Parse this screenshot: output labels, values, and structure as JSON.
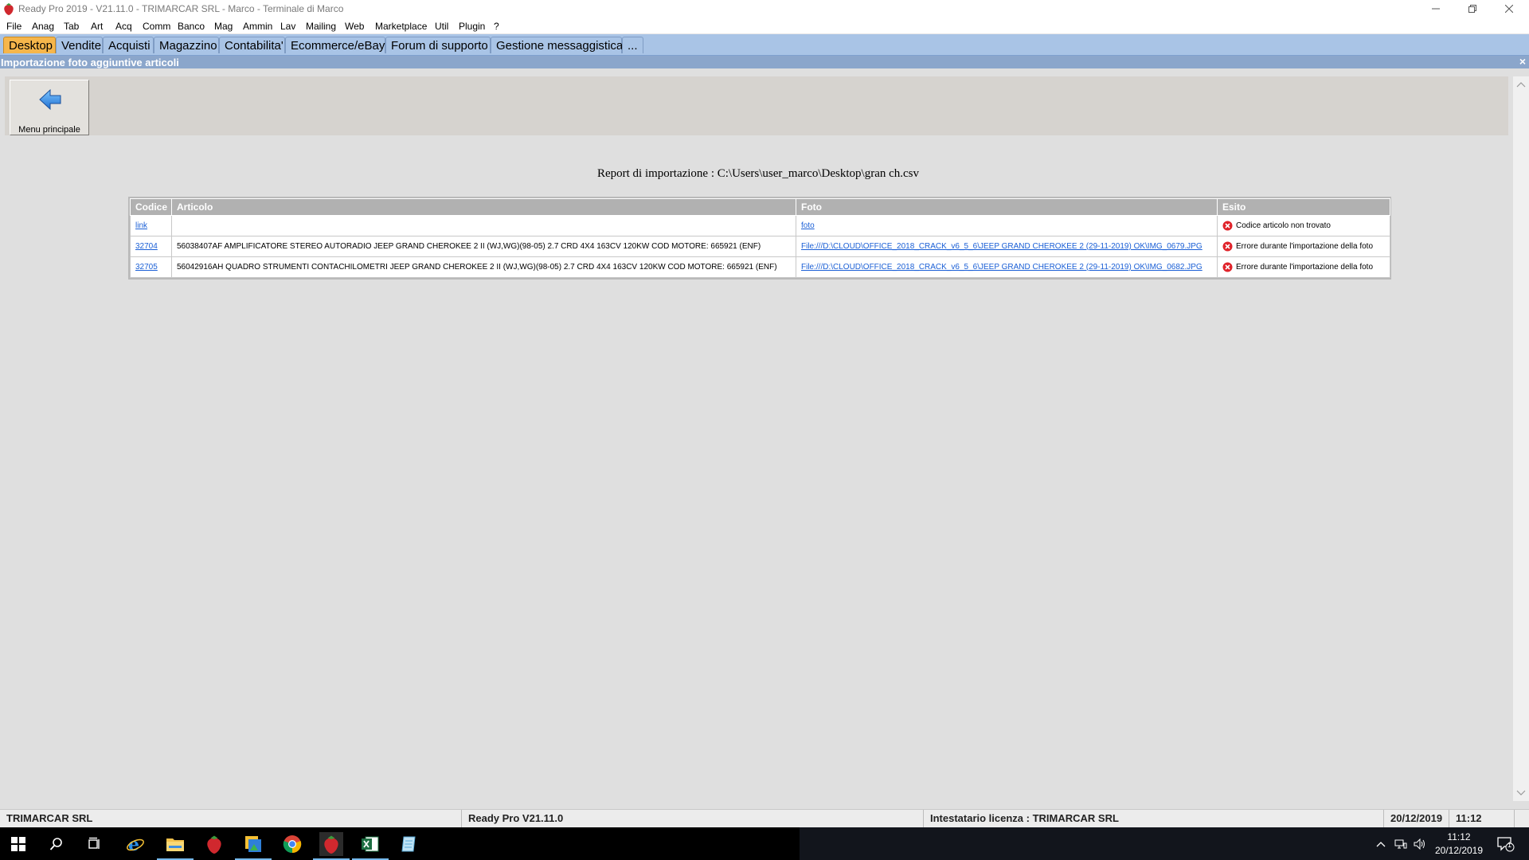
{
  "window": {
    "title": "Ready Pro 2019 - V21.11.0 - TRIMARCAR SRL - Marco - Terminale di Marco"
  },
  "menu": [
    "File",
    "Anag",
    "Tab",
    "Art",
    "Acq",
    "Comm",
    "Banco",
    "Mag",
    "Ammin",
    "Lav",
    "Mailing",
    "Web",
    "Marketplace",
    "Util",
    "Plugin",
    "?"
  ],
  "tabs": [
    {
      "label": "Desktop",
      "active": true
    },
    {
      "label": "Vendite"
    },
    {
      "label": "Acquisti"
    },
    {
      "label": "Magazzino"
    },
    {
      "label": "Contabilita'"
    },
    {
      "label": "Ecommerce/eBay"
    },
    {
      "label": "Forum di supporto"
    },
    {
      "label": "Gestione messaggistica"
    },
    {
      "label": "..."
    }
  ],
  "panel": {
    "title": "Importazione foto aggiuntive articoli",
    "close": "×",
    "back_button_label": "Menu principale"
  },
  "report": {
    "title": "Report di importazione : C:\\Users\\user_marco\\Desktop\\gran ch.csv",
    "columns": [
      "Codice",
      "Articolo",
      "Foto",
      "Esito"
    ],
    "rows": [
      {
        "codice": "link",
        "articolo": "",
        "foto": "foto",
        "esito": "Codice articolo non trovato"
      },
      {
        "codice": "32704",
        "articolo": "56038407AF AMPLIFICATORE STEREO AUTORADIO JEEP GRAND CHEROKEE 2 II (WJ,WG)(98-05) 2.7 CRD 4X4 163CV 120KW COD MOTORE: 665921 (ENF)",
        "foto": "File:///D:\\CLOUD\\OFFICE_2018_CRACK_v6_5_6\\JEEP GRAND CHEROKEE 2 (29-11-2019) OK\\IMG_0679.JPG",
        "esito": "Errore durante l'importazione della foto"
      },
      {
        "codice": "32705",
        "articolo": "56042916AH QUADRO STRUMENTI CONTACHILOMETRI JEEP GRAND CHEROKEE 2 II (WJ,WG)(98-05) 2.7 CRD 4X4 163CV 120KW COD MOTORE: 665921 (ENF)",
        "foto": "File:///D:\\CLOUD\\OFFICE_2018_CRACK_v6_5_6\\JEEP GRAND CHEROKEE 2 (29-11-2019) OK\\IMG_0682.JPG",
        "esito": "Errore durante l'importazione della foto"
      }
    ]
  },
  "status": {
    "company": "TRIMARCAR SRL",
    "version": "Ready Pro V21.11.0",
    "license": "Intestatario licenza : TRIMARCAR SRL",
    "date": "20/12/2019",
    "time": "11:12"
  },
  "taskbar": {
    "clock_time": "11:12",
    "clock_date": "20/12/2019",
    "notification_count": "1",
    "icons": [
      "windows-start-icon",
      "search-icon",
      "task-view-icon",
      "internet-explorer-icon",
      "file-explorer-icon",
      "ready-pro-icon",
      "image-app-icon",
      "chrome-icon",
      "ready-pro-icon",
      "excel-icon",
      "notepad-icon"
    ]
  },
  "colors": {
    "active_tab": "#f6b64b",
    "tabs_bar": "#a9c4e6",
    "header": "#8ba6cb",
    "link": "#1a5fd6",
    "error": "#e0232a"
  }
}
